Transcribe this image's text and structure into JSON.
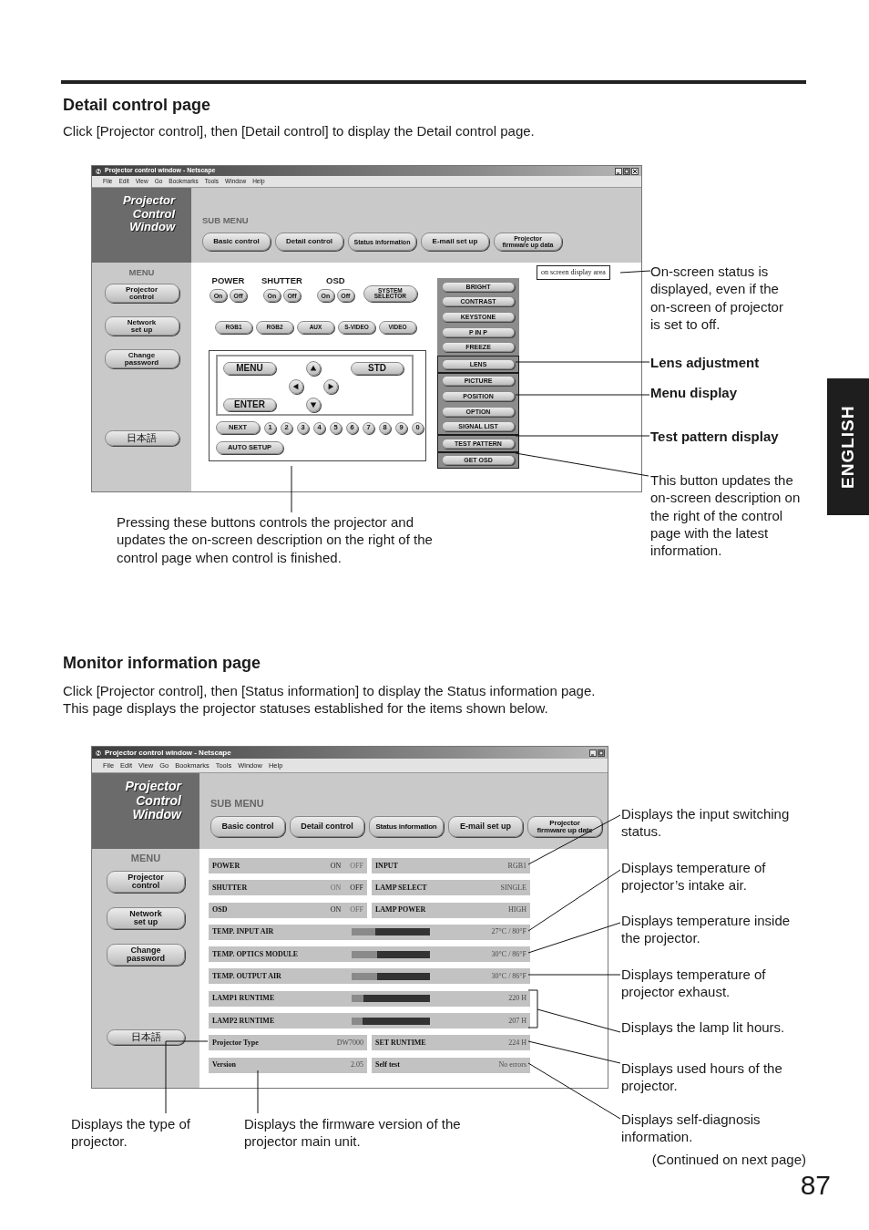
{
  "english_tab": "ENGLISH",
  "detail_section": {
    "heading": "Detail control page",
    "paragraphs": [
      "Click [Projector control], then [Detail control] to display the Detail control page."
    ],
    "window": {
      "title": "Projector control window - Netscape",
      "closable": true,
      "menu_bar": [
        "File",
        "Edit",
        "View",
        "Go",
        "Bookmarks",
        "Tools",
        "Window",
        "Help"
      ],
      "logo": [
        "Projector",
        "Control",
        "Window"
      ],
      "sub_menu_label": "SUB MENU",
      "sub_menu": [
        {
          "lines": [
            "Basic control"
          ]
        },
        {
          "lines": [
            "Detail control"
          ]
        },
        {
          "lines": [
            "Status information"
          ]
        },
        {
          "lines": [
            "E-mail set up"
          ]
        },
        {
          "lines": [
            "Projector",
            "firmware up data"
          ]
        }
      ],
      "menu_label": "MENU",
      "menu": [
        {
          "lines": [
            "Projector",
            "control"
          ]
        },
        {
          "lines": [
            "Network",
            "set up"
          ]
        },
        {
          "lines": [
            "Change",
            "password"
          ]
        },
        {
          "lines": [
            "日本語"
          ]
        }
      ],
      "toggles": [
        {
          "label": "POWER",
          "buttons": [
            "On",
            "Off"
          ]
        },
        {
          "label": "SHUTTER",
          "buttons": [
            "On",
            "Off"
          ]
        },
        {
          "label": "OSD",
          "buttons": [
            "On",
            "Off"
          ]
        }
      ],
      "system_selector": [
        "SYSTEM",
        "SELECTOR"
      ],
      "inputs": [
        "RGB1",
        "RGB2",
        "AUX",
        "S-VIDEO",
        "VIDEO"
      ],
      "remote": {
        "menu": "MENU",
        "std": "STD",
        "enter": "ENTER"
      },
      "next": "NEXT",
      "digits": [
        "1",
        "2",
        "3",
        "4",
        "5",
        "6",
        "7",
        "8",
        "9",
        "0"
      ],
      "auto_setup": "AUTO SETUP",
      "function_groups": [
        {
          "highlighted": false,
          "buttons": [
            "BRIGHT",
            "CONTRAST",
            "KEYSTONE",
            "P IN P",
            "FREEZE"
          ]
        },
        {
          "highlighted": true,
          "buttons": [
            "LENS"
          ]
        },
        {
          "highlighted": true,
          "buttons": [
            "PICTURE",
            "POSITION",
            "OPTION",
            "SIGNAL LIST"
          ]
        },
        {
          "highlighted": true,
          "buttons": [
            "TEST PATTERN"
          ]
        },
        {
          "highlighted": true,
          "buttons": [
            "GET OSD"
          ]
        }
      ],
      "osd_area": "on screen display area"
    },
    "callouts": [
      {
        "text": "On-screen status is displayed, even if the on-screen of projector is set to off.",
        "bold": false
      },
      {
        "text": "Lens adjustment",
        "bold": true
      },
      {
        "text": "Menu display",
        "bold": true
      },
      {
        "text": "Test pattern display",
        "bold": true
      },
      {
        "text": "This button updates the on-screen description on the right of the control page with the latest information.",
        "bold": false
      }
    ],
    "caption": "Pressing these buttons controls the projector and updates the on-screen description on the right of the control page when control is finished."
  },
  "monitor_section": {
    "heading": "Monitor information page",
    "paragraphs": [
      "Click [Projector control], then [Status information] to display the Status information page.",
      "This page displays the projector statuses established for the items shown below."
    ],
    "window": {
      "title": "Projector control window - Netscape",
      "closable": false,
      "menu_bar": [
        "File",
        "Edit",
        "View",
        "Go",
        "Bookmarks",
        "Tools",
        "Window",
        "Help"
      ],
      "logo": [
        "Projector",
        "Control",
        "Window"
      ],
      "sub_menu_label": "SUB MENU",
      "sub_menu": [
        {
          "lines": [
            "Basic control"
          ]
        },
        {
          "lines": [
            "Detail control"
          ]
        },
        {
          "lines": [
            "Status information"
          ]
        },
        {
          "lines": [
            "E-mail set up"
          ]
        },
        {
          "lines": [
            "Projector",
            "firmware up date"
          ]
        }
      ],
      "menu_label": "MENU",
      "menu": [
        {
          "lines": [
            "Projector",
            "control"
          ]
        },
        {
          "lines": [
            "Network",
            "set up"
          ]
        },
        {
          "lines": [
            "Change",
            "password"
          ]
        },
        {
          "lines": [
            "日本語"
          ]
        }
      ],
      "status_rows": [
        {
          "kind": "pair",
          "cells": [
            {
              "kind": "switch",
              "label": "POWER",
              "on_text": "ON",
              "off_text": "OFF",
              "on": true
            },
            {
              "kind": "value",
              "label": "INPUT",
              "value": "RGB1"
            }
          ]
        },
        {
          "kind": "pair",
          "cells": [
            {
              "kind": "switch",
              "label": "SHUTTER",
              "on_text": "ON",
              "off_text": "OFF",
              "on": false
            },
            {
              "kind": "value",
              "label": "LAMP SELECT",
              "value": "SINGLE"
            }
          ]
        },
        {
          "kind": "pair",
          "cells": [
            {
              "kind": "switch",
              "label": "OSD",
              "on_text": "ON",
              "off_text": "OFF",
              "on": true
            },
            {
              "kind": "value",
              "label": "LAMP POWER",
              "value": "HIGH"
            }
          ]
        },
        {
          "kind": "meter",
          "label": "TEMP. INPUT AIR",
          "level": 0.3,
          "reading": "27°C / 80°F"
        },
        {
          "kind": "meter",
          "label": "TEMP. OPTICS MODULE",
          "level": 0.32,
          "reading": "30°C / 86°F"
        },
        {
          "kind": "meter",
          "label": "TEMP. OUTPUT AIR",
          "level": 0.32,
          "reading": "30°C / 86°F"
        },
        {
          "kind": "meter",
          "label": "LAMP1 RUNTIME",
          "level": 0.15,
          "reading": "220 H"
        },
        {
          "kind": "meter",
          "label": "LAMP2 RUNTIME",
          "level": 0.14,
          "reading": "207 H"
        },
        {
          "kind": "pair",
          "cells": [
            {
              "kind": "value",
              "label": "Projector Type",
              "value": "DW7000"
            },
            {
              "kind": "value",
              "label": "SET RUNTIME",
              "value": "224 H"
            }
          ]
        },
        {
          "kind": "pair",
          "cells": [
            {
              "kind": "value",
              "label": "Version",
              "value": "2.05"
            },
            {
              "kind": "value",
              "label": "Self test",
              "value": "No errors"
            }
          ]
        }
      ]
    },
    "callouts": [
      {
        "text": "Displays the input switching status."
      },
      {
        "text": "Displays temperature of projector’s intake air."
      },
      {
        "text": "Displays temperature inside the projector."
      },
      {
        "text": "Displays temperature of projector exhaust."
      },
      {
        "text": "Displays the lamp lit hours."
      },
      {
        "text": "Displays used hours of the projector."
      },
      {
        "text": "Displays self-diagnosis information."
      }
    ],
    "bottom_callouts": [
      {
        "text": "Displays the type of projector."
      },
      {
        "text": "Displays the firmware version of the projector main unit."
      }
    ]
  },
  "continued": "(Continued on next page)",
  "page_number": "87"
}
